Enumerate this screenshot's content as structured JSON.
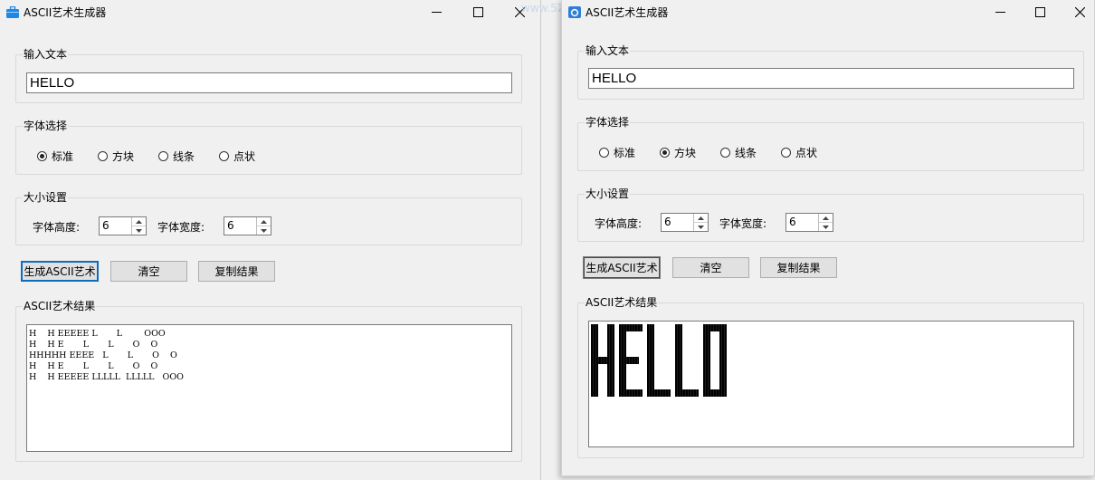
{
  "windows": [
    {
      "title": "ASCII艺术生成器",
      "input_group_label": "输入文本",
      "input_value": "HELLO",
      "font_group_label": "字体选择",
      "fonts": [
        "标准",
        "方块",
        "线条",
        "点状"
      ],
      "selected_font": 0,
      "size_group_label": "大小设置",
      "height_label": "字体高度:",
      "height_value": "6",
      "width_label": "字体宽度:",
      "width_value": "6",
      "buttons": {
        "generate": "生成ASCII艺术",
        "clear": "清空",
        "copy": "复制结果"
      },
      "result_group_label": "ASCII艺术结果",
      "result_text": "H    H EEEEE L       L        OOO\nH    H E       L       L       O    O\nHHHHH EEEE   L       L       O    O\nH    H E       L       L       O    O\nH    H EEEEE LLLLL  LLLLL   OOO"
    },
    {
      "title": "ASCII艺术生成器",
      "input_group_label": "输入文本",
      "input_value": "HELLO",
      "font_group_label": "字体选择",
      "fonts": [
        "标准",
        "方块",
        "线条",
        "点状"
      ],
      "selected_font": 1,
      "size_group_label": "大小设置",
      "height_label": "字体高度:",
      "height_value": "6",
      "width_label": "字体宽度:",
      "width_value": "6",
      "buttons": {
        "generate": "生成ASCII艺术",
        "clear": "清空",
        "copy": "复制结果"
      },
      "result_group_label": "ASCII艺术结果",
      "block_letters": [
        "H",
        "E",
        "L",
        "L",
        "O"
      ]
    }
  ],
  "icons": {
    "left_app_icon": "briefcase-icon",
    "right_app_icon": "camera-icon",
    "minimize": "minimize-icon",
    "maximize": "maximize-icon",
    "close": "close-icon"
  },
  "colors": {
    "accent": "#0f6cbd",
    "app_icon_left": "#1e88e5",
    "app_icon_right": "#2f7fd8"
  }
}
